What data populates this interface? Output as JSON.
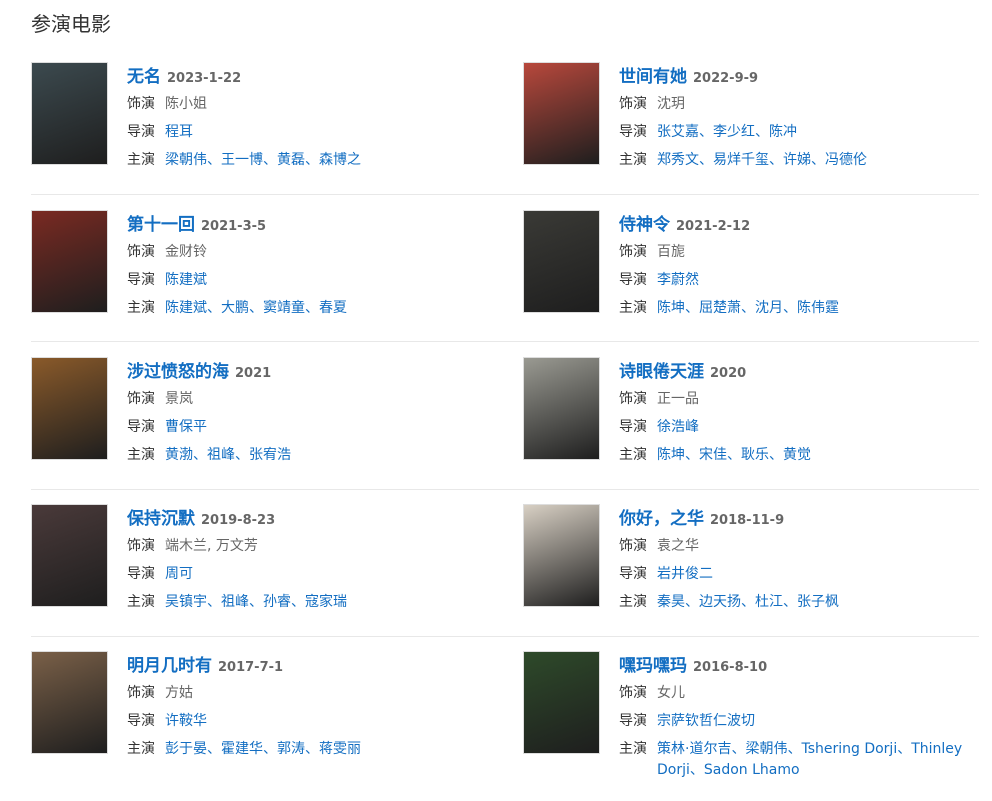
{
  "section_title": "参演电影",
  "labels": {
    "role": "饰演",
    "director": "导演",
    "cast": "主演"
  },
  "separator": "、",
  "movies": [
    {
      "title": "无名",
      "date": "2023-1-22",
      "role": "陈小姐",
      "director": "程耳",
      "cast": [
        "梁朝伟",
        "王一博",
        "黄磊",
        "森博之"
      ]
    },
    {
      "title": "世间有她",
      "date": "2022-9-9",
      "role": "沈玥",
      "director": "张艾嘉、李少红、陈冲",
      "cast": [
        "郑秀文",
        "易烊千玺",
        "许娣",
        "冯德伦"
      ]
    },
    {
      "title": "第十一回",
      "date": "2021-3-5",
      "role": "金财铃",
      "director": "陈建斌",
      "cast": [
        "陈建斌",
        "大鹏",
        "窦靖童",
        "春夏"
      ]
    },
    {
      "title": "侍神令",
      "date": "2021-2-12",
      "role": "百旎",
      "director": "李蔚然",
      "cast": [
        "陈坤",
        "屈楚萧",
        "沈月",
        "陈伟霆"
      ]
    },
    {
      "title": "涉过愤怒的海",
      "date": "2021",
      "role": "景岚",
      "director": "曹保平",
      "cast": [
        "黄渤",
        "祖峰",
        "张宥浩"
      ]
    },
    {
      "title": "诗眼倦天涯",
      "date": "2020",
      "role": "正一品",
      "director": "徐浩峰",
      "cast": [
        "陈坤",
        "宋佳",
        "耿乐",
        "黄觉"
      ]
    },
    {
      "title": "保持沉默",
      "date": "2019-8-23",
      "role": "端木兰, 万文芳",
      "director": "周可",
      "cast": [
        "吴镇宇",
        "祖峰",
        "孙睿",
        "寇家瑞"
      ]
    },
    {
      "title": "你好，之华",
      "date": "2018-11-9",
      "role": "袁之华",
      "director": "岩井俊二",
      "cast": [
        "秦昊",
        "边天扬",
        "杜江",
        "张子枫"
      ]
    },
    {
      "title": "明月几时有",
      "date": "2017-7-1",
      "role": "方姑",
      "director": "许鞍华",
      "cast": [
        "彭于晏",
        "霍建华",
        "郭涛",
        "蒋雯丽"
      ]
    },
    {
      "title": "嘿玛嘿玛",
      "date": "2016-8-10",
      "role": "女儿",
      "director": "宗萨钦哲仁波切",
      "cast": [
        "策林·道尔吉",
        "梁朝伟",
        "Tshering Dorji",
        "Thinley Dorji",
        "Sadon Lhamo"
      ]
    }
  ],
  "poster_colors": [
    "#3c4a4f",
    "#b8483c",
    "#7a2a22",
    "#3a3a36",
    "#8a5a2a",
    "#9a9a92",
    "#4a3a3a",
    "#d8d0c4",
    "#7a6048",
    "#2e4a2a"
  ]
}
